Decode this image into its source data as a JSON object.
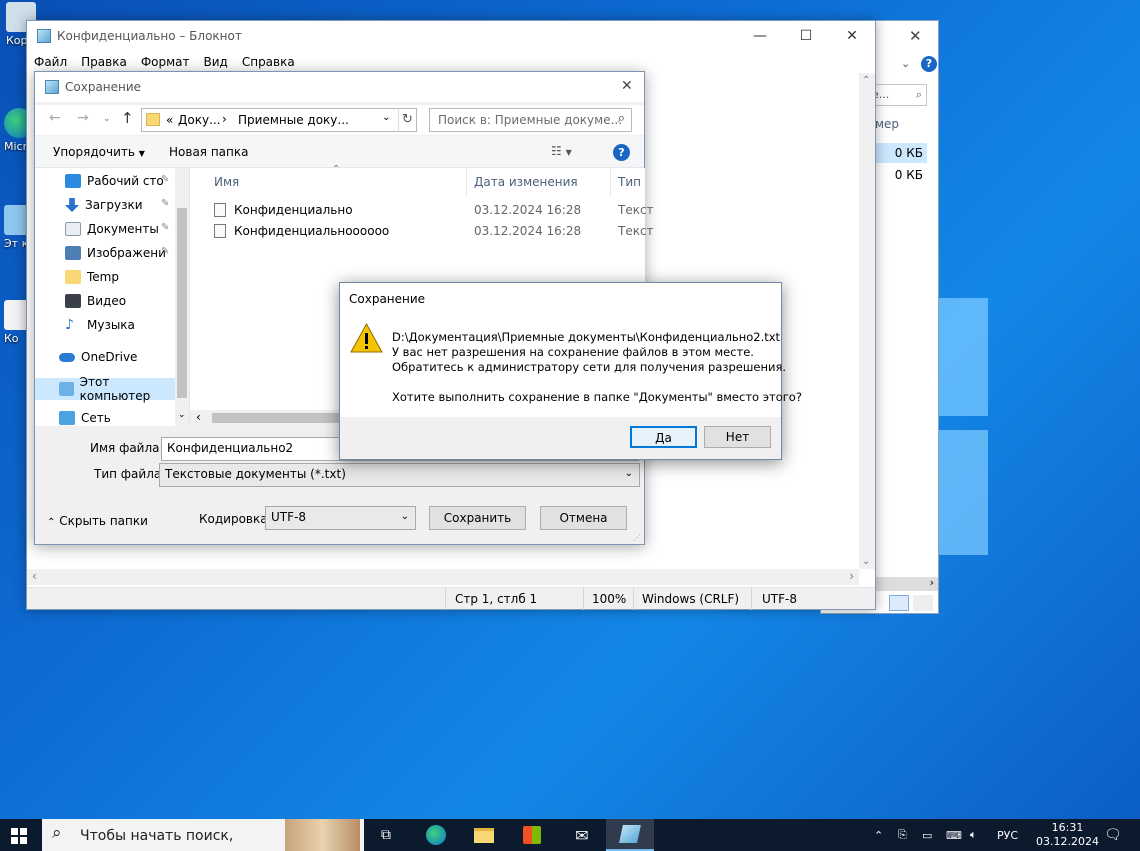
{
  "colors": {
    "accent": "#0078d7",
    "desktop": "#0d6fd6",
    "warning": "#f5c400"
  },
  "desktop": {
    "icons": [
      {
        "label": "Кор",
        "icon": "recycle-bin-icon"
      },
      {
        "label": "Micr Ed",
        "icon": "edge-icon"
      },
      {
        "label": "Эт комп",
        "icon": "this-pc-shortcut-icon"
      },
      {
        "label": "Ко",
        "icon": "document-shortcut-icon"
      }
    ]
  },
  "back_window": {
    "search_placeholder": "е...",
    "size_header": "мер",
    "sizes": [
      "0 КБ",
      "0 КБ"
    ]
  },
  "notepad": {
    "title": "Конфиденциально – Блокнот",
    "menu": [
      "Файл",
      "Правка",
      "Формат",
      "Вид",
      "Справка"
    ],
    "status": {
      "position": "Стр 1, стлб 1",
      "zoom": "100%",
      "line_ending": "Windows (CRLF)",
      "encoding": "UTF-8"
    }
  },
  "save_dialog": {
    "title": "Сохранение",
    "breadcrumb": [
      "«",
      "Доку...",
      "›",
      "Приемные доку..."
    ],
    "search_placeholder": "Поиск в: Приемные докуме...",
    "organize_label": "Упорядочить",
    "new_folder_label": "Новая папка",
    "nav_items": [
      {
        "label": "Рабочий сто",
        "icon": "desktop-folder-icon",
        "pinned": true
      },
      {
        "label": "Загрузки",
        "icon": "downloads-icon",
        "pinned": true
      },
      {
        "label": "Документы",
        "icon": "documents-icon",
        "pinned": true
      },
      {
        "label": "Изображени",
        "icon": "pictures-icon",
        "pinned": true
      },
      {
        "label": "Temp",
        "icon": "folder-icon",
        "pinned": false
      },
      {
        "label": "Видео",
        "icon": "videos-icon",
        "pinned": false
      },
      {
        "label": "Музыка",
        "icon": "music-icon",
        "pinned": false
      },
      {
        "label": "OneDrive",
        "icon": "onedrive-icon",
        "pinned": false
      },
      {
        "label": "Этот компьютер",
        "icon": "this-pc-icon",
        "pinned": false
      },
      {
        "label": "Сеть",
        "icon": "network-icon",
        "pinned": false
      }
    ],
    "columns": {
      "name": "Имя",
      "date": "Дата изменения",
      "type": "Тип"
    },
    "files": [
      {
        "name": "Конфиденциально",
        "date": "03.12.2024 16:28",
        "type": "Текст"
      },
      {
        "name": "Конфиденциальноооооо",
        "date": "03.12.2024 16:28",
        "type": "Текст"
      }
    ],
    "filename_label": "Имя файла:",
    "filename_value": "Конфиденциально2",
    "filetype_label": "Тип файла:",
    "filetype_value": "Текстовые документы (*.txt)",
    "hide_folders_label": "Скрыть папки",
    "encoding_label": "Кодировка:",
    "encoding_value": "UTF-8",
    "save_button": "Сохранить",
    "cancel_button": "Отмена"
  },
  "alert": {
    "title": "Сохранение",
    "line1": "D:\\Документация\\Приемные документы\\Конфиденциально2.txt",
    "line2": "У вас нет разрешения на сохранение файлов в этом месте.",
    "line3": "Обратитесь к администратору сети для получения разрешения.",
    "question": "Хотите выполнить сохранение в папке \"Документы\" вместо этого?",
    "yes_button": "Да",
    "no_button": "Нет"
  },
  "taskbar": {
    "search_placeholder": "Чтобы начать поиск,",
    "language": "РУС",
    "time": "16:31",
    "date": "03.12.2024"
  }
}
